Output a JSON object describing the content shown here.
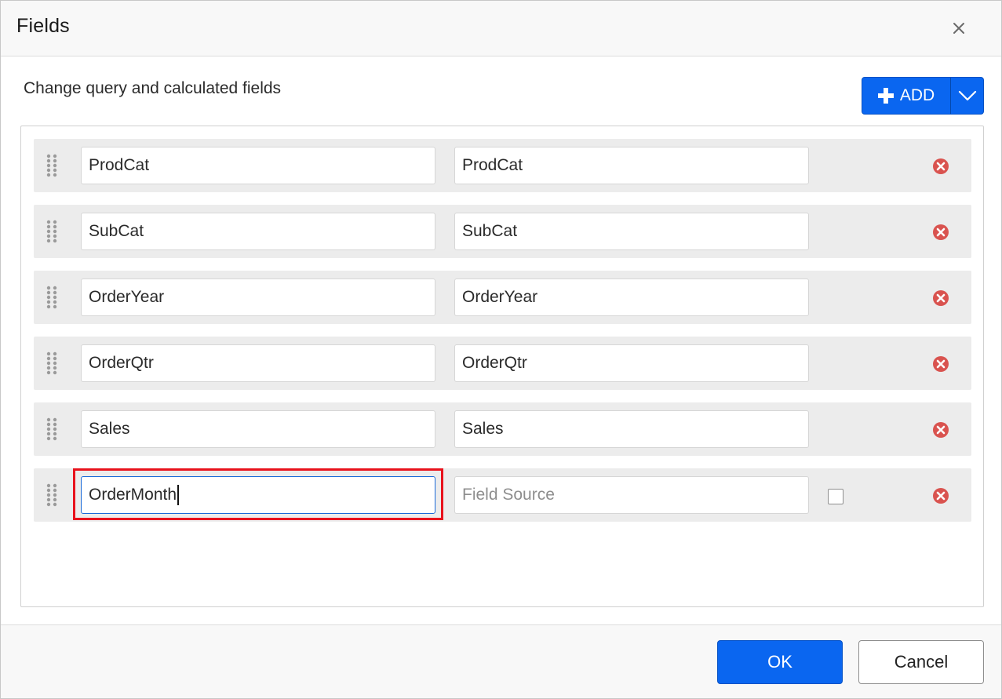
{
  "dialog": {
    "title": "Fields",
    "subtitle": "Change query and calculated fields",
    "add_label": "ADD",
    "ok_label": "OK",
    "cancel_label": "Cancel"
  },
  "fields": [
    {
      "name": "ProdCat",
      "source": "ProdCat",
      "source_placeholder": "",
      "focused": false,
      "has_checkbox": false
    },
    {
      "name": "SubCat",
      "source": "SubCat",
      "source_placeholder": "",
      "focused": false,
      "has_checkbox": false
    },
    {
      "name": "OrderYear",
      "source": "OrderYear",
      "source_placeholder": "",
      "focused": false,
      "has_checkbox": false
    },
    {
      "name": "OrderQtr",
      "source": "OrderQtr",
      "source_placeholder": "",
      "focused": false,
      "has_checkbox": false
    },
    {
      "name": "Sales",
      "source": "Sales",
      "source_placeholder": "",
      "focused": false,
      "has_checkbox": false
    },
    {
      "name": "OrderMonth",
      "source": "",
      "source_placeholder": "Field Source",
      "focused": true,
      "has_checkbox": true
    }
  ],
  "icons": {
    "close": "close-icon",
    "add": "plus-icon",
    "dropdown": "chevron-down-icon",
    "drag": "drag-handle-icon",
    "remove": "remove-circle-icon"
  },
  "colors": {
    "primary": "#0a66f0",
    "remove": "#d9534f",
    "highlight": "#e8121c"
  }
}
